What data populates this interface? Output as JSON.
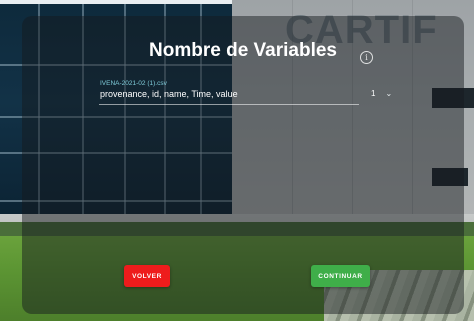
{
  "dialog": {
    "title": "Nombre de Variables",
    "info_icon": "info-icon",
    "file_label": "IVENA-2021-02 (1).csv",
    "columns_value": "provenance, id, name, Time, value",
    "selector": {
      "value": "1",
      "icon": "chevron-down-icon"
    }
  },
  "actions": {
    "back_label": "VOLVER",
    "continue_label": "CONTINUAR"
  },
  "colors": {
    "back_button": "#ee1c1c",
    "continue_button": "#3fae49",
    "file_label": "#7ecbd9"
  }
}
